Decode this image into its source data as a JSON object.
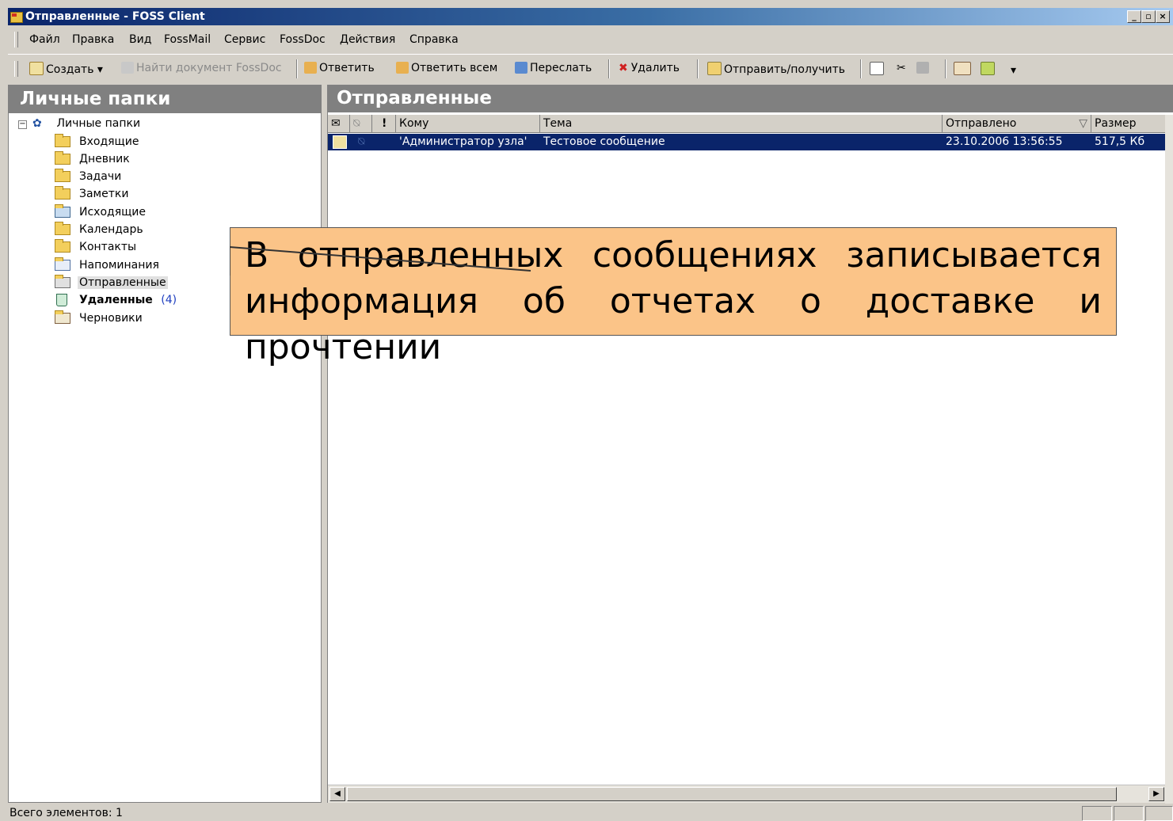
{
  "window": {
    "title": "Отправленные - FOSS Client",
    "controls": [
      "_",
      "▫",
      "×"
    ]
  },
  "menu": [
    "Файл",
    "Правка",
    "Вид",
    "FossMail",
    "Сервис",
    "FossDoc",
    "Действия",
    "Справка"
  ],
  "toolbar": {
    "create": "Создать",
    "find": "Найти документ FossDoc",
    "reply": "Ответить",
    "reply_all": "Ответить всем",
    "forward": "Переслать",
    "delete": "Удалить",
    "send_receive": "Отправить/получить"
  },
  "left_pane": {
    "header": "Личные папки",
    "root": "Личные папки",
    "folders": [
      {
        "label": "Входящие",
        "icon": "inbox-icon"
      },
      {
        "label": "Дневник",
        "icon": "folder-icon"
      },
      {
        "label": "Задачи",
        "icon": "folder-icon"
      },
      {
        "label": "Заметки",
        "icon": "folder-icon"
      },
      {
        "label": "Исходящие",
        "icon": "outbox-icon"
      },
      {
        "label": "Календарь",
        "icon": "folder-icon"
      },
      {
        "label": "Контакты",
        "icon": "folder-icon"
      },
      {
        "label": "Напоминания",
        "icon": "calendar-grid-icon"
      },
      {
        "label": "Отправленные",
        "icon": "sent-icon"
      },
      {
        "label": "Удаленные",
        "icon": "trash-icon",
        "count": "(4)"
      },
      {
        "label": "Черновики",
        "icon": "drafts-icon"
      }
    ]
  },
  "right_pane": {
    "header": "Отправленные",
    "columns": {
      "to": "Кому",
      "subject": "Тема",
      "sent": "Отправлено",
      "size": "Размер"
    },
    "rows": [
      {
        "to": "'Администратор узла'",
        "subject": "Тестовое сообщение",
        "sent": "23.10.2006 13:56:55",
        "size": "517,5 Кб"
      }
    ]
  },
  "callout": "В отправленных сообщениях записывается информация об отчетах о доставке и прочтении",
  "status": "Всего элементов: 1",
  "colors": {
    "selection": "#0a246a",
    "callout_bg": "#fbc488",
    "pane_header": "#808080"
  }
}
